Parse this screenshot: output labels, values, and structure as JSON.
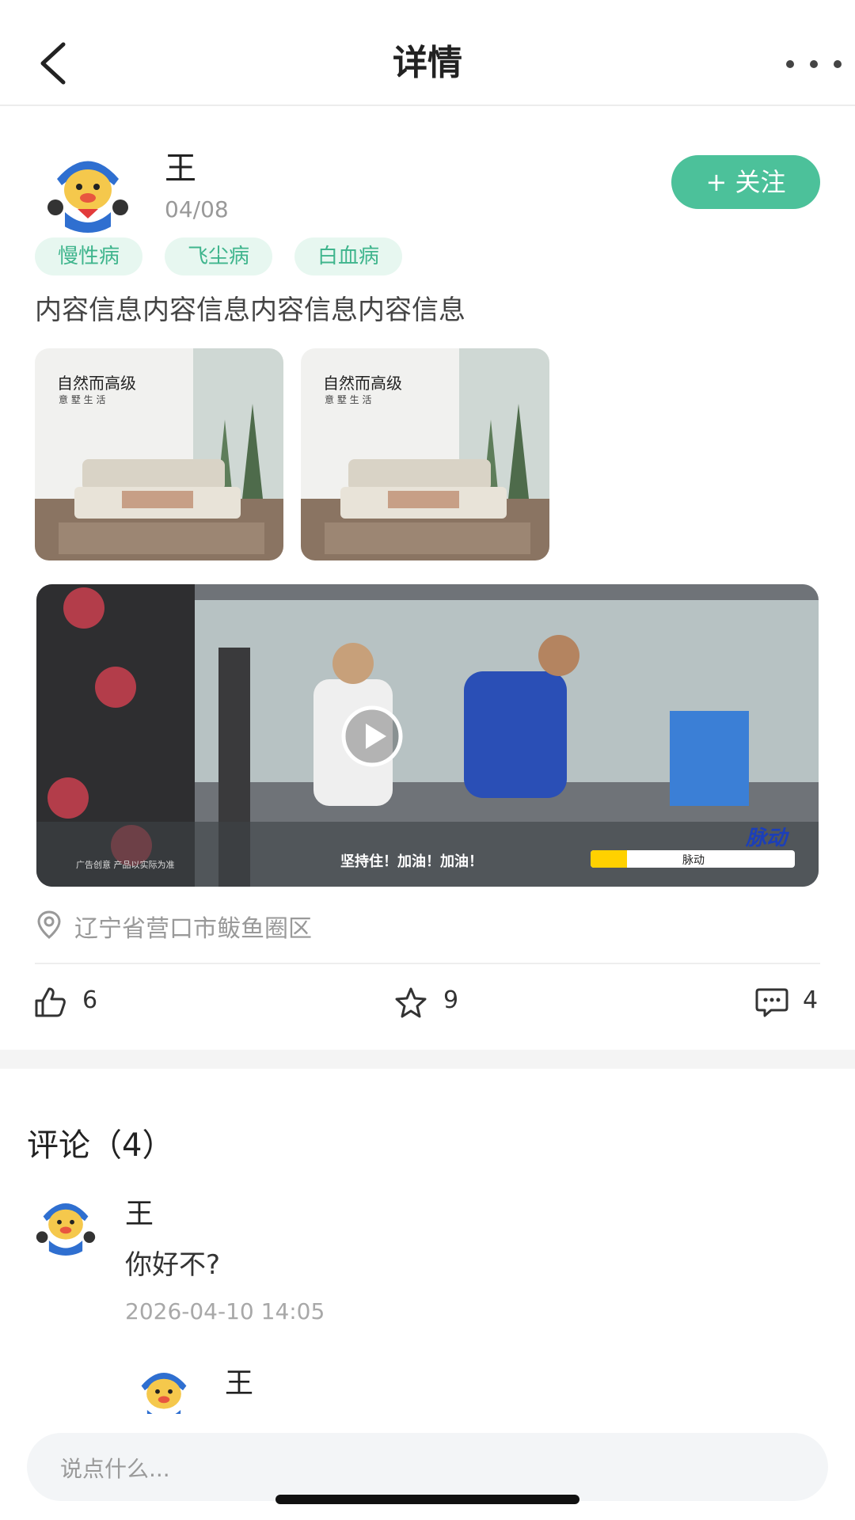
{
  "header": {
    "title": "详情"
  },
  "post": {
    "author": "王",
    "date": "04/08",
    "follow_label": "+ 关注",
    "tags": [
      "慢性病",
      "飞尘病",
      "白血病"
    ],
    "content": "内容信息内容信息内容信息内容信息",
    "images": [
      {
        "headline": "自然而高级",
        "sub": "意 墅 生 活"
      },
      {
        "headline": "自然而高级",
        "sub": "意 墅 生 活"
      }
    ],
    "video": {
      "caption": "坚持住！加油！加油！",
      "small_text": "广告创意 产品以实际为准",
      "search_text": "脉动",
      "brand": "脉动"
    },
    "location": "辽宁省营口市鲅鱼圈区",
    "stats": {
      "likes": "6",
      "favorites": "9",
      "comments": "4"
    }
  },
  "comments": {
    "title": "评论（4）",
    "items": [
      {
        "name": "王",
        "text": "你好不?",
        "time": "2026-04-10 14:05"
      },
      {
        "name": "王"
      }
    ]
  },
  "input": {
    "placeholder": "说点什么..."
  },
  "colors": {
    "accent": "#4cc19a",
    "tag_bg": "#e7f7f0",
    "tag_text": "#3fb58d"
  }
}
